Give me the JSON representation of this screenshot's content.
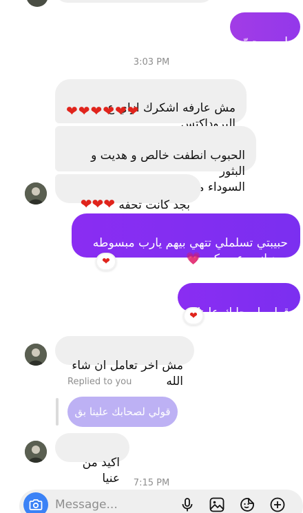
{
  "colors": {
    "sent_bubble": "#7b2ff0",
    "sent_bubble_top": "#9e3be8",
    "received_bubble": "#efefef",
    "reaction_heart": "#e0241c",
    "camera_button": "#3b82f6",
    "timestamp_text": "#8e8e8e"
  },
  "messages": {
    "sent_1": "اه يروحيّ",
    "time_1": "3:03 PM",
    "recv_1_text": "مش عارفه اشكرك ازاي ع البروداكتس\nالقمر دي",
    "recv_1_hearts": "❤❤❤❤❤❤",
    "recv_2": "الحبوب انطفت خالص و هديت و البثور\nالسوداء معظمها طلع ف ايدي",
    "recv_3_text": "بجد كانت تحفه ",
    "recv_3_hearts": "❤❤❤",
    "sent_2_text": "حبيبتي تسلملي تتهي بيهم يارب مبسوطه\nبجد إنهم عجبوكي ",
    "sent_2_emoji": "💗",
    "sent_2_reaction": "❤",
    "sent_3": "قولي لصحابك علينا بق",
    "sent_3_reaction": "❤",
    "recv_4": "مش اخر تعامل ان شاء الله",
    "replied_label": "Replied to you",
    "reply_preview": "قولي لصحابك علينا بق",
    "recv_5": "اكيد من عنيا",
    "time_2": "7:15 PM"
  },
  "composer": {
    "placeholder": "Message...",
    "camera_icon": "camera-icon",
    "mic_icon": "microphone-icon",
    "gallery_icon": "image-icon",
    "sticker_icon": "sticker-icon",
    "plus_icon": "plus-icon"
  }
}
